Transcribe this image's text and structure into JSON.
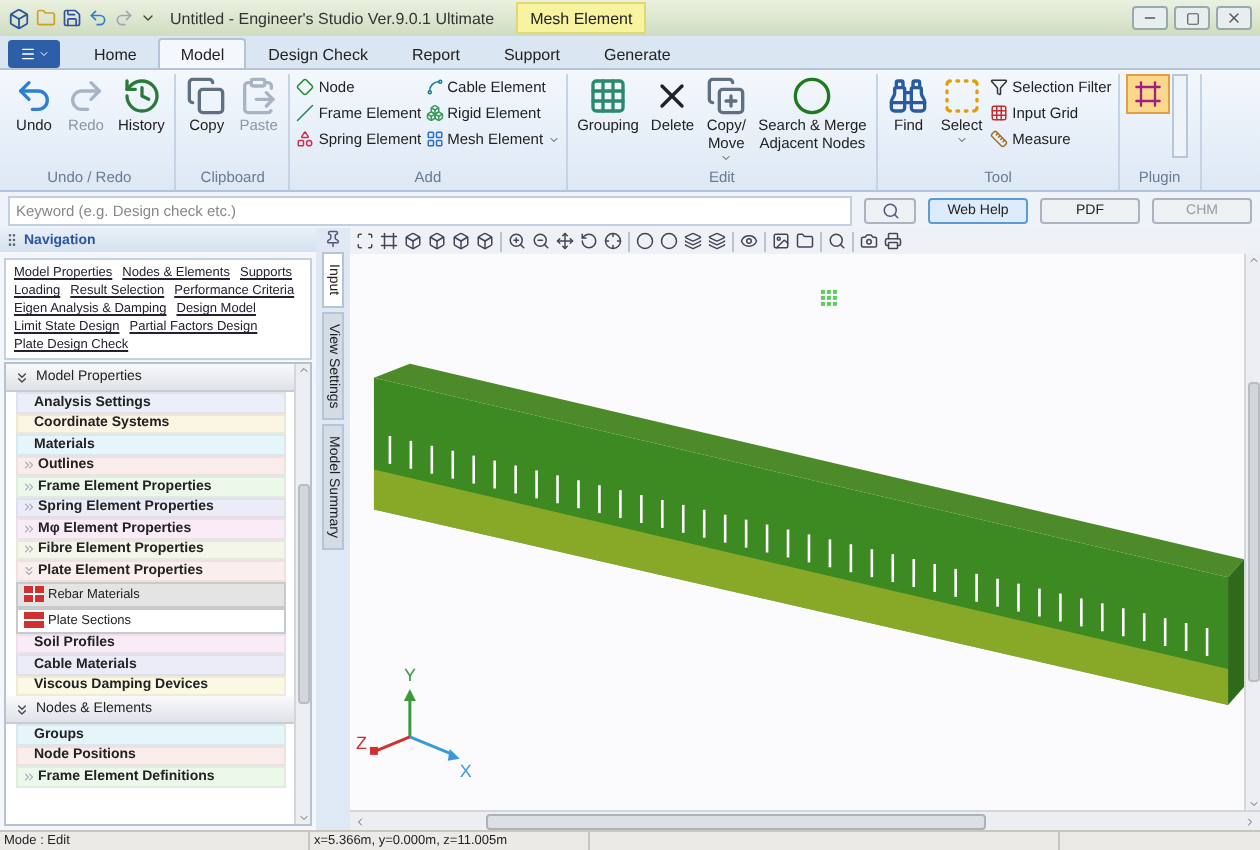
{
  "window": {
    "title": "Untitled - Engineer's Studio Ver.9.0.1 Ultimate",
    "context_tab": "Mesh Element"
  },
  "tabs": [
    {
      "label": "Home",
      "selected": false
    },
    {
      "label": "Model",
      "selected": true
    },
    {
      "label": "Design Check",
      "selected": false
    },
    {
      "label": "Report",
      "selected": false
    },
    {
      "label": "Support",
      "selected": false
    },
    {
      "label": "Generate",
      "selected": false
    }
  ],
  "ribbon": [
    {
      "label": "Undo / Redo",
      "items": [
        {
          "kind": "large",
          "label": "Undo",
          "disabled": false
        },
        {
          "kind": "large",
          "label": "Redo",
          "disabled": true
        },
        {
          "kind": "large",
          "label": "History",
          "disabled": false
        }
      ]
    },
    {
      "label": "Clipboard",
      "items": [
        {
          "kind": "large",
          "label": "Copy",
          "disabled": false
        },
        {
          "kind": "large",
          "label": "Paste",
          "disabled": true
        }
      ]
    },
    {
      "label": "Add",
      "items": [
        {
          "kind": "small",
          "label": "Node",
          "dropdown": false
        },
        {
          "kind": "small",
          "label": "Frame Element",
          "dropdown": false
        },
        {
          "kind": "small",
          "label": "Spring Element",
          "dropdown": false
        },
        {
          "kind": "small",
          "label": "Cable Element",
          "dropdown": false
        },
        {
          "kind": "small",
          "label": "Rigid Element",
          "dropdown": false
        },
        {
          "kind": "small",
          "label": "Mesh Element",
          "dropdown": true
        }
      ]
    },
    {
      "label": "Edit",
      "items": [
        {
          "kind": "large",
          "label": "Grouping",
          "disabled": false
        },
        {
          "kind": "large",
          "label": "Delete",
          "disabled": false
        },
        {
          "kind": "large",
          "label": "Copy/\nMove",
          "disabled": false,
          "dropdown": true
        },
        {
          "kind": "large",
          "label": "Search & Merge\nAdjacent Nodes",
          "disabled": false
        }
      ]
    },
    {
      "label": "Tool",
      "items": [
        {
          "kind": "large",
          "label": "Find",
          "disabled": false
        },
        {
          "kind": "large",
          "label": "Select",
          "disabled": false,
          "dropdown": true
        },
        {
          "kind": "small",
          "label": "Selection Filter",
          "dropdown": false
        },
        {
          "kind": "small",
          "label": "Input Grid",
          "dropdown": false
        },
        {
          "kind": "small",
          "label": "Measure",
          "dropdown": false
        }
      ]
    },
    {
      "label": "Plugin",
      "items": [
        {
          "kind": "gallery"
        }
      ]
    }
  ],
  "search": {
    "placeholder": "Keyword (e.g. Design check etc.)",
    "buttons": [
      {
        "label": "Web Help",
        "disabled": false,
        "selected": true
      },
      {
        "label": "PDF",
        "disabled": false,
        "selected": false
      },
      {
        "label": "CHM",
        "disabled": true,
        "selected": false
      }
    ]
  },
  "navigation": {
    "title": "Navigation",
    "links": [
      [
        "Model Properties",
        "Nodes & Elements",
        "Supports"
      ],
      [
        "Loading",
        "Result Selection",
        "Performance Criteria"
      ],
      [
        "Eigen Analysis & Damping",
        "Design Model"
      ],
      [
        "Limit State Design",
        "Partial Factors Design"
      ],
      [
        "Plate Design Check"
      ]
    ],
    "sections": [
      {
        "title": "Model Properties",
        "expanded": true,
        "items": [
          {
            "kind": "leaf",
            "label": "Analysis Settings",
            "color": "#eceff9"
          },
          {
            "kind": "leaf",
            "label": "Coordinate Systems",
            "color": "#fbf5e4"
          },
          {
            "kind": "leaf",
            "label": "Materials",
            "color": "#e5f5fa"
          },
          {
            "kind": "group",
            "label": "Outlines",
            "expanded": false,
            "color": "#faeceb"
          },
          {
            "kind": "group",
            "label": "Frame Element Properties",
            "expanded": false,
            "color": "#ecf9ea"
          },
          {
            "kind": "group",
            "label": "Spring Element Properties",
            "expanded": false,
            "color": "#ececf9"
          },
          {
            "kind": "group",
            "label": "Mφ Element Properties",
            "expanded": false,
            "color": "#f9ecf7"
          },
          {
            "kind": "group",
            "label": "Fibre Element Properties",
            "expanded": false,
            "color": "#f3f6e9"
          },
          {
            "kind": "group",
            "label": "Plate Element Properties",
            "expanded": true,
            "color": "#faefec",
            "children": [
              {
                "label": "Rebar Materials",
                "selected": true
              },
              {
                "label": "Plate Sections",
                "selected": false
              }
            ]
          },
          {
            "kind": "leaf",
            "label": "Soil Profiles",
            "color": "#f9ecf7"
          },
          {
            "kind": "leaf",
            "label": "Cable Materials",
            "color": "#ececf9"
          },
          {
            "kind": "leaf",
            "label": "Viscous Damping Devices",
            "color": "#fbf8e4"
          }
        ]
      },
      {
        "title": "Nodes & Elements",
        "expanded": true,
        "items": [
          {
            "kind": "leaf",
            "label": "Groups",
            "color": "#e5f5fa"
          },
          {
            "kind": "leaf",
            "label": "Node Positions",
            "color": "#faeceb"
          },
          {
            "kind": "group",
            "label": "Frame Element Definitions",
            "expanded": false,
            "color": "#ecf9ea"
          }
        ]
      }
    ]
  },
  "side_tabs": [
    {
      "label": "Input",
      "selected": true
    },
    {
      "label": "View Settings",
      "selected": false
    },
    {
      "label": "Model Summary",
      "selected": false
    }
  ],
  "viewport": {
    "axes": [
      {
        "label": "Y"
      },
      {
        "label": "Z"
      },
      {
        "label": "X"
      }
    ]
  },
  "status_bar": {
    "mode": "Mode : Edit",
    "coordinates": "x=5.366m, y=0.000m, z=11.005m"
  }
}
